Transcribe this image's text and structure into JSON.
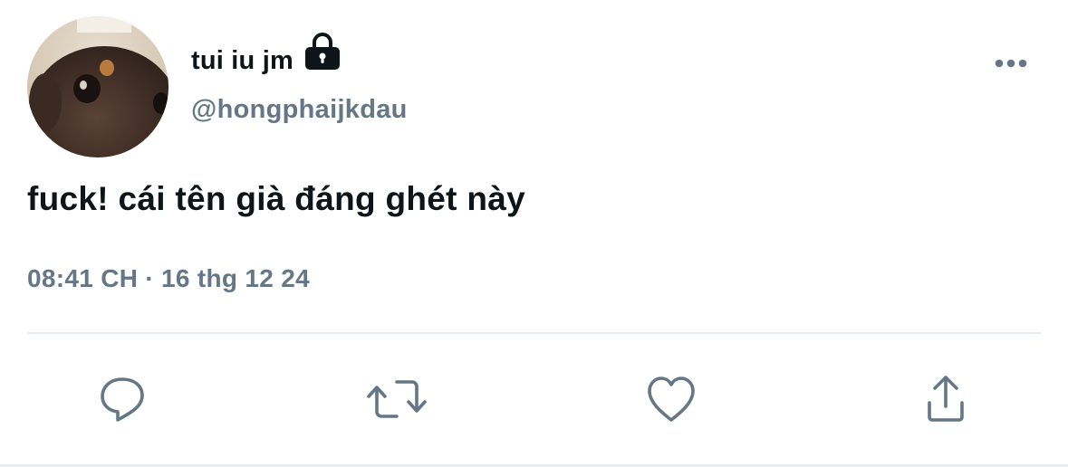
{
  "tweet": {
    "author": {
      "display_name": "tui iu jm",
      "handle": "@hongphaijkdau",
      "protected": true,
      "avatar_icon": "avatar-dog-photo",
      "lock_icon": "lock-icon"
    },
    "text": "fuck! cái tên già đáng ghét này",
    "time": "08:41 CH",
    "separator": "·",
    "date": "16 thg 12 24",
    "more_icon": "more-horizontal-icon"
  },
  "actions": [
    {
      "name": "reply",
      "icon": "reply-icon"
    },
    {
      "name": "retweet",
      "icon": "retweet-icon"
    },
    {
      "name": "like",
      "icon": "heart-icon"
    },
    {
      "name": "share",
      "icon": "share-icon"
    }
  ],
  "colors": {
    "text_primary": "#0f1419",
    "text_secondary": "#657786",
    "divider": "#e6ecf0",
    "icon": "#657786"
  }
}
